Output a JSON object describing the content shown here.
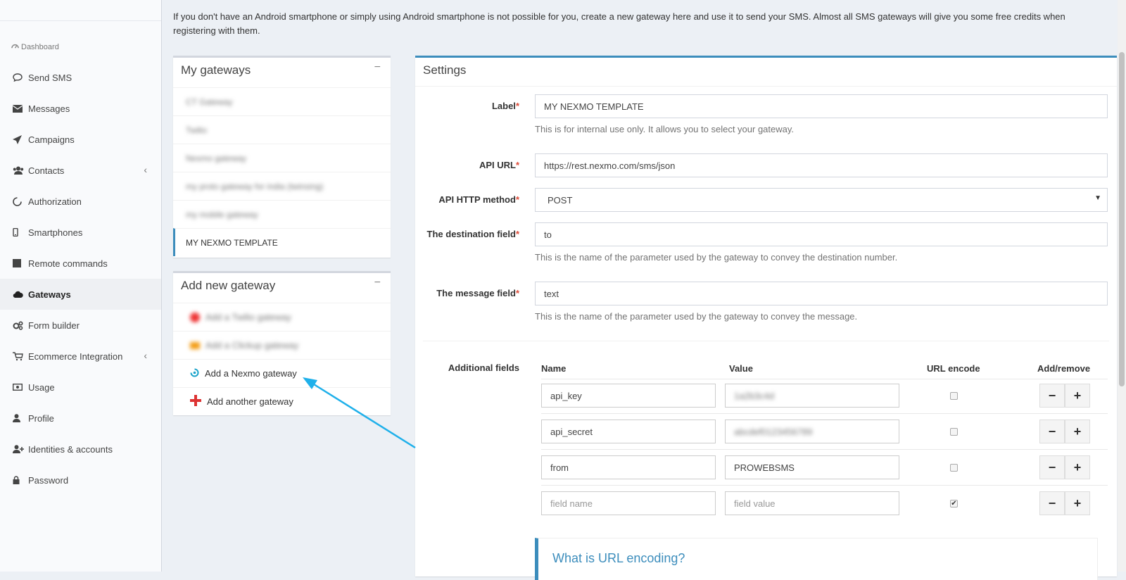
{
  "intro": {
    "text": "If you don't have an Android smartphone or simply using Android smartphone is not possible for you, create a new gateway here and use it to send your SMS. Almost all SMS gateways will give you some free credits when registering with them."
  },
  "sidebar": {
    "header": "Dashboard",
    "items": [
      {
        "label": "Send SMS",
        "icon": "chat-icon"
      },
      {
        "label": "Messages",
        "icon": "envelope-icon"
      },
      {
        "label": "Campaigns",
        "icon": "paper-plane-icon"
      },
      {
        "label": "Contacts",
        "icon": "users-icon"
      },
      {
        "label": "Authorization",
        "icon": "circle-notch-icon"
      },
      {
        "label": "Smartphones",
        "icon": "mobile-icon"
      },
      {
        "label": "Remote commands",
        "icon": "terminal-icon"
      },
      {
        "label": "Gateways",
        "icon": "cloud-icon"
      },
      {
        "label": "Form builder",
        "icon": "cogs-icon"
      },
      {
        "label": "Ecommerce Integration",
        "icon": "cart-icon"
      },
      {
        "label": "Usage",
        "icon": "money-icon"
      },
      {
        "label": "Profile",
        "icon": "user-icon"
      },
      {
        "label": "Identities & accounts",
        "icon": "user-plus-icon"
      },
      {
        "label": "Password",
        "icon": "lock-icon"
      }
    ]
  },
  "my_gateways": {
    "title": "My gateways",
    "collapse": "−",
    "items": [
      "CT Gateway",
      "Twilio",
      "Nexmo gateway",
      "my proto gateway for india (twinsing)",
      "my mobile gateway"
    ],
    "selected": "MY NEXMO TEMPLATE"
  },
  "add_gateway": {
    "title": "Add new gateway",
    "collapse": "−",
    "blurred_items": [
      "Add a Twilio gateway",
      "Add a Clickup gateway"
    ],
    "nexmo": "Add a Nexmo gateway",
    "another": "Add another gateway"
  },
  "settings": {
    "title": "Settings",
    "label": {
      "name": "Label",
      "value": "MY NEXMO TEMPLATE",
      "help": "This is for internal use only. It allows you to select your gateway."
    },
    "api_url": {
      "name": "API URL",
      "value": "https://rest.nexmo.com/sms/json"
    },
    "method": {
      "name": "API HTTP method",
      "value": "POST"
    },
    "destination": {
      "name": "The destination field",
      "value": "to",
      "help": "This is the name of the parameter used by the gateway to convey the destination number."
    },
    "message": {
      "name": "The message field",
      "value": "text",
      "help": "This is the name of the parameter used by the gateway to convey the message."
    },
    "required_mark": "*",
    "additional": {
      "label": "Additional fields",
      "headers": {
        "name": "Name",
        "value": "Value",
        "url_encode": "URL encode",
        "add_remove": "Add/remove"
      },
      "rows": [
        {
          "name": "api_key",
          "value": "1a2b3c4d",
          "checked": false
        },
        {
          "name": "api_secret",
          "value": "abcdef0123456789",
          "checked": false
        },
        {
          "name": "from",
          "value": "PROWEBSMS",
          "checked": false
        },
        {
          "name": "",
          "value": "",
          "checked": true
        }
      ],
      "name_placeholder": "field name",
      "value_placeholder": "field value",
      "minus": "−",
      "plus": "+"
    },
    "callout_title": "What is URL encoding?"
  },
  "colors": {
    "accent": "#3c8dbc",
    "required": "#dd4b39",
    "arrow": "#1fb0ea"
  }
}
